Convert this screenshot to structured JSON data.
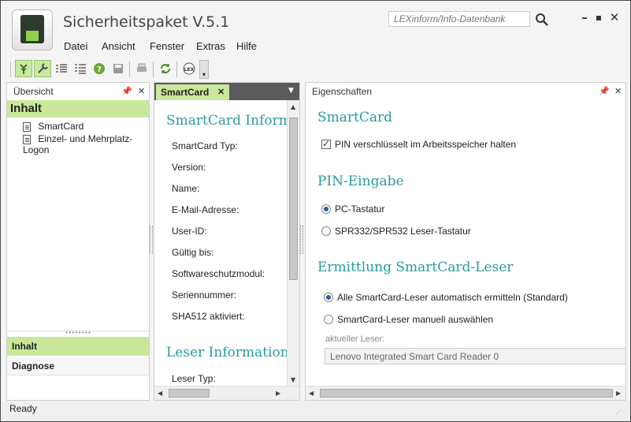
{
  "app": {
    "title": "Sicherheitspaket V.5.1"
  },
  "search": {
    "placeholder": "LEXinform/Info-Datenbank"
  },
  "menu": [
    "Datei",
    "Ansicht",
    "Fenster",
    "Extras",
    "Hilfe"
  ],
  "toolbar": {
    "lex_label": "LEX"
  },
  "left_pane": {
    "title": "Übersicht",
    "section": "Inhalt",
    "items": [
      "SmartCard",
      "Einzel- und Mehrplatz-Logon"
    ],
    "nav": [
      "Inhalt",
      "Diagnose"
    ]
  },
  "middle_pane": {
    "tab": "SmartCard",
    "heading1": "SmartCard Information",
    "fields": [
      "SmartCard Typ:",
      "Version:",
      "Name:",
      "E-Mail-Adresse:",
      "User-ID:",
      "Gültig bis:",
      "Softwareschutzmodul:",
      "Seriennummer:",
      "SHA512 aktiviert:"
    ],
    "heading2": "Leser Information",
    "fields2": [
      "Leser Typ:"
    ]
  },
  "right_pane": {
    "title": "Eigenschaften",
    "smartcard_heading": "SmartCard",
    "pin_checkbox_label": "PIN verschlüsselt im Arbeitsspeicher halten",
    "pin_checkbox_checked": true,
    "pin_heading": "PIN-Eingabe",
    "pin_options": [
      "PC-Tastatur",
      "SPR332/SPR532 Leser-Tastatur"
    ],
    "pin_selected": 0,
    "reader_heading": "Ermittlung SmartCard-Leser",
    "reader_options": [
      "Alle SmartCard-Leser automatisch ermitteln (Standard)",
      "SmartCard-Leser manuell auswählen"
    ],
    "reader_selected": 0,
    "current_reader_label": "aktueller Leser:",
    "current_reader_value": "Lenovo Integrated Smart Card Reader 0"
  },
  "status": {
    "text": "Ready"
  },
  "colors": {
    "accent_green": "#c9e89b",
    "heading_teal": "#2a9b9a",
    "dark_bar": "#5a5a5a"
  }
}
